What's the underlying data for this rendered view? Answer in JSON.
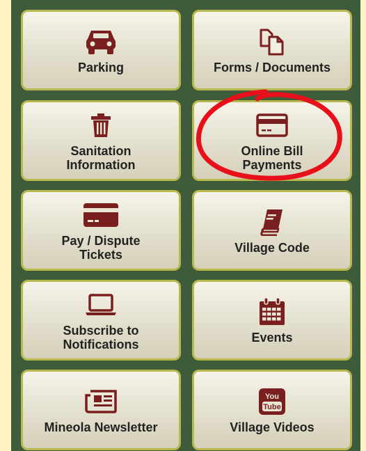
{
  "tiles": [
    {
      "label": "Parking",
      "icon": "car-icon"
    },
    {
      "label": "Forms / Documents",
      "icon": "documents-icon"
    },
    {
      "label": "Sanitation\nInformation",
      "icon": "trash-can-icon"
    },
    {
      "label": "Online Bill\nPayments",
      "icon": "credit-card-icon"
    },
    {
      "label": "Pay / Dispute\nTickets",
      "icon": "credit-card-icon"
    },
    {
      "label": "Village Code",
      "icon": "book-icon"
    },
    {
      "label": "Subscribe to\nNotifications",
      "icon": "laptop-icon"
    },
    {
      "label": "Events",
      "icon": "calendar-icon"
    },
    {
      "label": "Mineola Newsletter",
      "icon": "newspaper-icon"
    },
    {
      "label": "Village Videos",
      "icon": "youtube-icon"
    }
  ],
  "youtube_text": {
    "top": "You",
    "bottom": "Tube"
  },
  "colors": {
    "icon": "#7a1f1f",
    "panel": "#3e5c3a",
    "tile_border": "#b8b84e",
    "highlight_circle": "#e8101a"
  }
}
